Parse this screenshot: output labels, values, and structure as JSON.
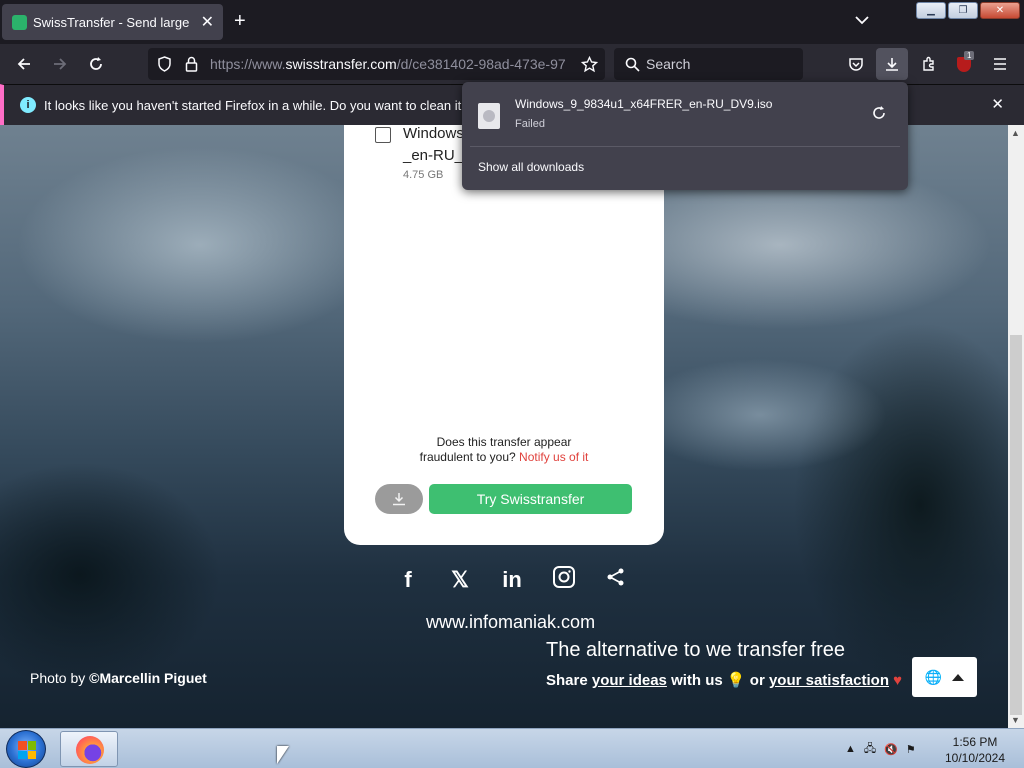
{
  "browser": {
    "tab_title": "SwissTransfer - Send large files",
    "url_prefix": "https://www.",
    "url_host": "swisstransfer.com",
    "url_path": "/d/ce381402-98ad-473e-97",
    "search_placeholder": "Search",
    "extension_badge": "1"
  },
  "notification": {
    "message": "It looks like you haven't started Firefox in a while. Do you want to clean it up for"
  },
  "downloads_panel": {
    "file_name": "Windows_9_9834u1_x64FRER_en-RU_DV9.iso",
    "status": "Failed",
    "show_all": "Show all downloads"
  },
  "card": {
    "file_name_line1": "Windows",
    "file_name_line2": "_en-RU_I",
    "file_size": "4.75 GB",
    "fraud_question_line1": "Does this transfer appear",
    "fraud_question_line2": "fraudulent to you?",
    "notify_link": "Notify us of it",
    "try_button": "Try Swisstransfer"
  },
  "footer": {
    "site": "www.infomaniak.com",
    "photo_credit_prefix": "Photo by",
    "photo_credit_name": "©Marcellin Piguet",
    "tagline": "The alternative to we transfer free",
    "share_prefix": "Share",
    "share_ideas": "your ideas",
    "share_mid": "with us",
    "share_or": "or",
    "share_satisfaction": "your satisfaction"
  },
  "taskbar": {
    "time": "1:56 PM",
    "date": "10/10/2024"
  }
}
